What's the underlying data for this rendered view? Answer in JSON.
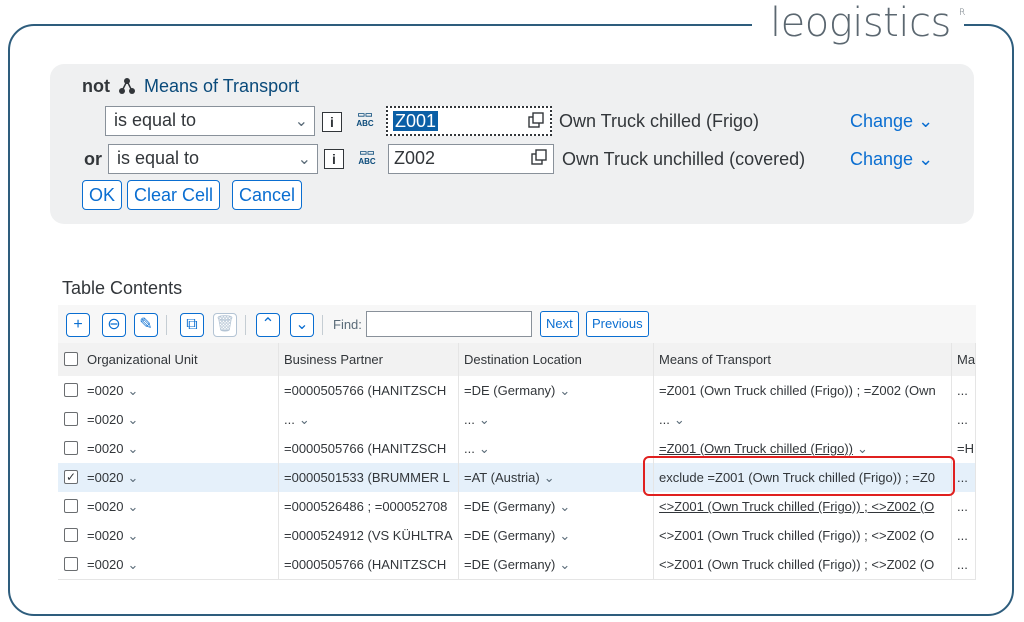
{
  "logo": {
    "text": "leogistics",
    "mark": "R"
  },
  "condition": {
    "prefix": "not",
    "field_label": "Means of Transport",
    "rows": [
      {
        "connector": "",
        "operator": "is equal to",
        "value": "Z001",
        "description": "Own Truck chilled (Frigo)",
        "change": "Change"
      },
      {
        "connector": "or",
        "operator": "is equal to",
        "value": "Z002",
        "description": "Own Truck unchilled (covered)",
        "change": "Change"
      }
    ],
    "buttons": {
      "ok": "OK",
      "clear": "Clear Cell",
      "cancel": "Cancel"
    }
  },
  "table": {
    "title": "Table Contents",
    "toolbar": {
      "find_label": "Find:",
      "find_value": "",
      "next": "Next",
      "previous": "Previous"
    },
    "columns": [
      "Organizational Unit",
      "Business Partner",
      "Destination Location",
      "Means of Transport",
      "Ma"
    ],
    "rows": [
      {
        "checked": false,
        "org": "=0020",
        "bp": "=0000505766 (HANITZSCH",
        "dest": "=DE (Germany)",
        "mot": "=Z001 (Own Truck chilled (Frigo)) ; =Z002 (Own",
        "more": "..."
      },
      {
        "checked": false,
        "org": "=0020",
        "bp": "...",
        "dest": "...",
        "mot": "...",
        "more": "..."
      },
      {
        "checked": false,
        "org": "=0020",
        "bp": "=0000505766 (HANITZSCH",
        "dest": "...",
        "mot": "=Z001 (Own Truck chilled (Frigo))",
        "more": "=H"
      },
      {
        "checked": true,
        "org": "=0020",
        "bp": "=0000501533 (BRUMMER L",
        "dest": "=AT (Austria)",
        "mot": "exclude =Z001 (Own Truck chilled (Frigo)) ; =Z0",
        "more": "..."
      },
      {
        "checked": false,
        "org": "=0020",
        "bp": "=0000526486 ; =000052708",
        "dest": "=DE (Germany)",
        "mot": "<>Z001 (Own Truck chilled (Frigo)) ; <>Z002 (O",
        "more": "..."
      },
      {
        "checked": false,
        "org": "=0020",
        "bp": "=0000524912 (VS KÜHLTRA",
        "dest": "=DE (Germany)",
        "mot": "<>Z001 (Own Truck chilled (Frigo)) ; <>Z002 (O",
        "more": "..."
      },
      {
        "checked": false,
        "org": "=0020",
        "bp": "=0000505766 (HANITZSCH",
        "dest": "=DE (Germany)",
        "mot": "<>Z001 (Own Truck chilled (Frigo)) ; <>Z002 (O",
        "more": "..."
      }
    ]
  }
}
